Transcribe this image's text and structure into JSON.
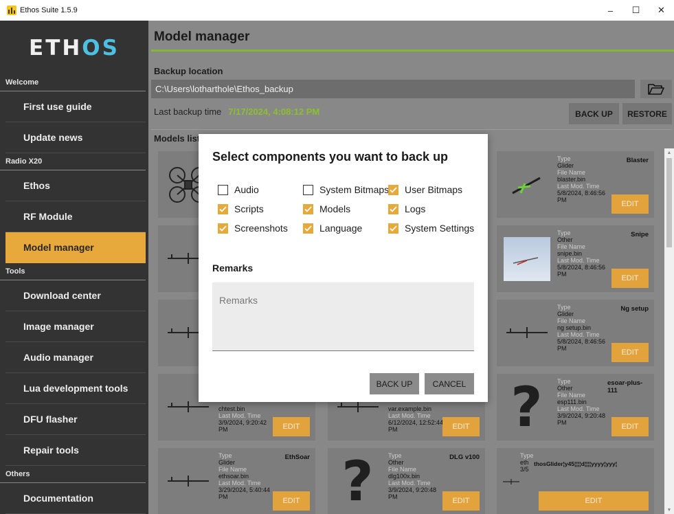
{
  "window": {
    "title": "Ethos Suite 1.5.9",
    "controls": [
      "–",
      "☐",
      "✕"
    ]
  },
  "sidebar": {
    "logo": {
      "part1": "ETH",
      "part2": "OS"
    },
    "sections": [
      {
        "label": "Welcome",
        "items": [
          "First use guide",
          "Update news"
        ]
      },
      {
        "label": "Radio X20",
        "items": [
          "Ethos",
          "RF Module",
          "Model manager"
        ]
      },
      {
        "label": "Tools",
        "items": [
          "Download center",
          "Image manager",
          "Audio manager",
          "Lua development tools",
          "DFU flasher",
          "Repair tools"
        ]
      },
      {
        "label": "Others",
        "items": [
          "Documentation"
        ]
      }
    ],
    "active_item": "Model manager"
  },
  "main": {
    "title": "Model manager",
    "backup_location_label": "Backup location",
    "backup_path": "C:\\Users\\lotharthole\\Ethos_backup",
    "last_backup_label": "Last backup time",
    "last_backup_value": "7/17/2024, 4:08:12 PM",
    "backup_button": "BACK UP",
    "restore_button": "RESTORE",
    "models_list_label": "Models list"
  },
  "models": [
    {
      "type": "Glider",
      "file": "blaster.bin",
      "time": "5/8/2024, 8:46:56 PM",
      "name": "Blaster",
      "edit": "EDIT"
    },
    {
      "type": "Other",
      "file": "snipe.bin",
      "time": "5/8/2024, 8:46:56 PM",
      "name": "Snipe",
      "edit": "EDIT"
    },
    {
      "type": "Glider",
      "file": "ng setup.bin",
      "time": "5/8/2024, 8:46:56 PM",
      "name": "Ng setup",
      "edit": "EDIT"
    },
    {
      "type": "Other",
      "file": "esp111.bin",
      "time": "3/9/2024, 9:20:48 PM",
      "name": "esoar-plus-111",
      "edit": "EDIT"
    },
    {
      "file": "chtest.bin",
      "time": "3/9/2024, 9:20:42 PM",
      "edit": "EDIT"
    },
    {
      "file": "var.example.bin",
      "time": "6/12/2024, 12:52:44 PM",
      "edit": "EDIT"
    },
    {
      "type": "Glider",
      "file": "ethsoar.bin",
      "time": "3/29/2024, 5:40:44 PM",
      "name": "EthSoar",
      "edit": "EDIT"
    },
    {
      "type": "Other",
      "file": "dlg100x.bin",
      "time": "3/9/2024, 9:20:48 PM",
      "name": "DLG v100",
      "edit": "EDIT"
    },
    {
      "file_partial": "eth",
      "time_partial": "3/5",
      "name": "thosGlider¦y45¦¦¦¦d¦¦¦¦yyyy¦yyy¦",
      "edit": "EDIT"
    }
  ],
  "labels": {
    "type": "Type",
    "file_name": "File Name",
    "last_mod": "Last Mod. Time"
  },
  "dialog": {
    "title": "Select components you want to back up",
    "options": [
      {
        "label": "Audio",
        "checked": false
      },
      {
        "label": "System Bitmaps",
        "checked": false
      },
      {
        "label": "User Bitmaps",
        "checked": true
      },
      {
        "label": "Scripts",
        "checked": true
      },
      {
        "label": "Models",
        "checked": true
      },
      {
        "label": "Logs",
        "checked": true
      },
      {
        "label": "Screenshots",
        "checked": true
      },
      {
        "label": "Language",
        "checked": true
      },
      {
        "label": "System Settings",
        "checked": true
      }
    ],
    "remarks_title": "Remarks",
    "remarks_placeholder": "Remarks",
    "backup_button": "BACK UP",
    "cancel_button": "CANCEL"
  },
  "colors": {
    "accent": "#e8a93c",
    "green": "#86b733",
    "logo_blue": "#4dbfe0"
  }
}
